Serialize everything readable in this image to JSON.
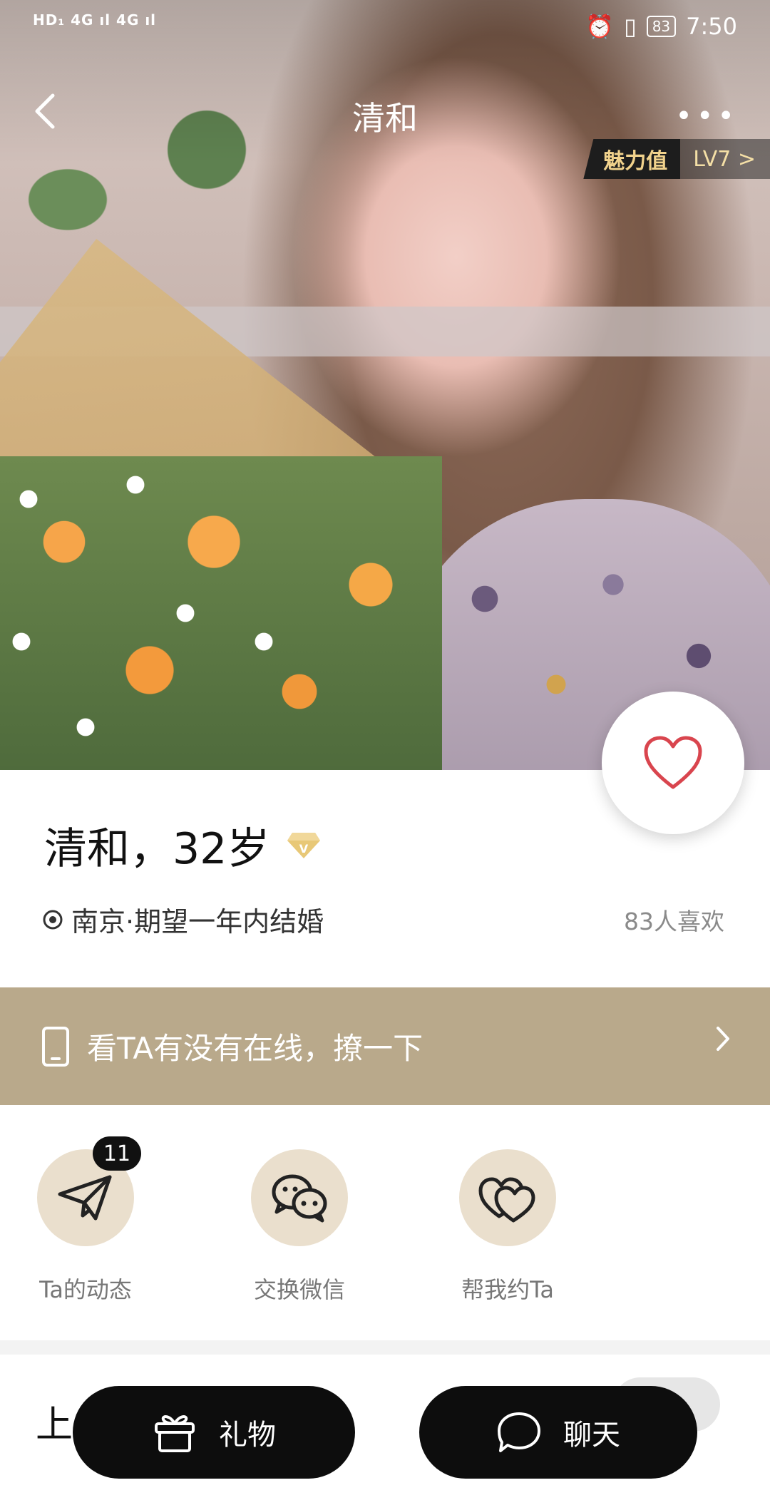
{
  "status_bar": {
    "left_indicators": "HD₁ 4G ıl 4G ıl",
    "battery": "83",
    "time": "7:50"
  },
  "nav": {
    "title": "清和",
    "charm_label": "魅力值",
    "charm_level": "LV7 >"
  },
  "profile": {
    "name_age": "清和，32岁",
    "location": "南京·期望一年内结婚",
    "likes": "83人喜欢"
  },
  "banner": {
    "text": "看TA有没有在线，撩一下"
  },
  "actions": [
    {
      "label": "Ta的动态",
      "badge": "11"
    },
    {
      "label": "交换微信"
    },
    {
      "label": "帮我约Ta"
    }
  ],
  "lower_section": {
    "title": "上"
  },
  "bottom_bar": {
    "gift_label": "礼物",
    "chat_label": "聊天"
  },
  "colors": {
    "banner_bg": "#b9a98b",
    "action_circle": "#eadfcd",
    "heart": "#d9454e",
    "vip_gold": "#d9b25c"
  }
}
